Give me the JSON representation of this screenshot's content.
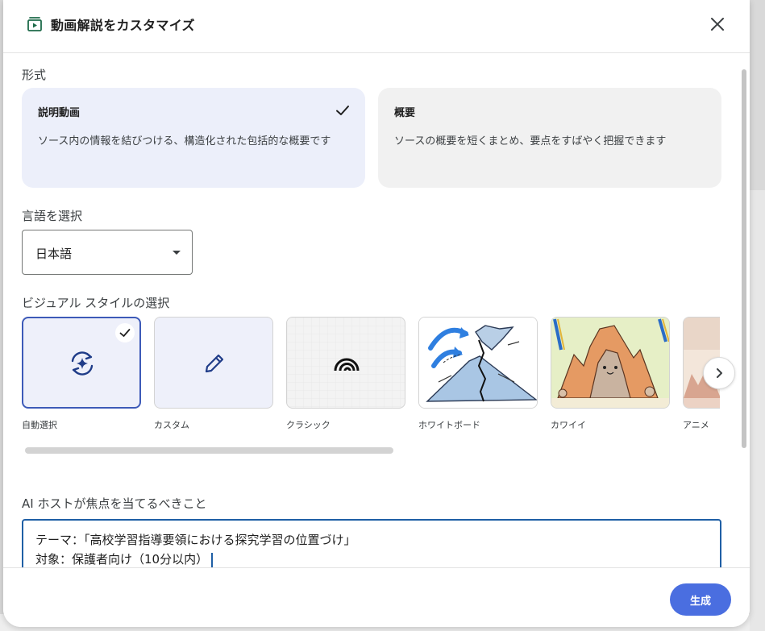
{
  "dialog": {
    "title": "動画解説をカスタマイズ",
    "icons": {
      "header": "video-library-icon",
      "close": "close-icon"
    }
  },
  "format": {
    "label": "形式",
    "options": [
      {
        "title": "説明動画",
        "description": "ソース内の情報を結びつける、構造化された包括的な概要です",
        "selected": true
      },
      {
        "title": "概要",
        "description": "ソースの概要を短くまとめ、要点をすばやく把握できます",
        "selected": false
      }
    ]
  },
  "language": {
    "label": "言語を選択",
    "selected": "日本語"
  },
  "visual_style": {
    "label": "ビジュアル スタイルの選択",
    "options": [
      {
        "label": "自動選択",
        "icon": "auto-select-sparkle-icon",
        "selected": true
      },
      {
        "label": "カスタム",
        "icon": "pencil-icon",
        "selected": false
      },
      {
        "label": "クラシック",
        "icon": "classic-arc-icon",
        "selected": false
      },
      {
        "label": "ホワイトボード",
        "icon": "whiteboard-volcano-image",
        "selected": false
      },
      {
        "label": "カワイイ",
        "icon": "kawaii-mountain-image",
        "selected": false
      },
      {
        "label": "アニメ",
        "icon": "anime-landscape-image",
        "selected": false
      }
    ]
  },
  "focus": {
    "label": "AI ホストが焦点を当てるべきこと",
    "lines": [
      "テーマ：「高校学習指導要領における探究学習の位置づけ」",
      "対象：保護者向け（10分以内）"
    ]
  },
  "footer": {
    "generate_label": "生成"
  },
  "colors": {
    "accent": "#4a6ee0",
    "selected_card": "#eceffa",
    "focus_border": "#1f5fa5"
  }
}
